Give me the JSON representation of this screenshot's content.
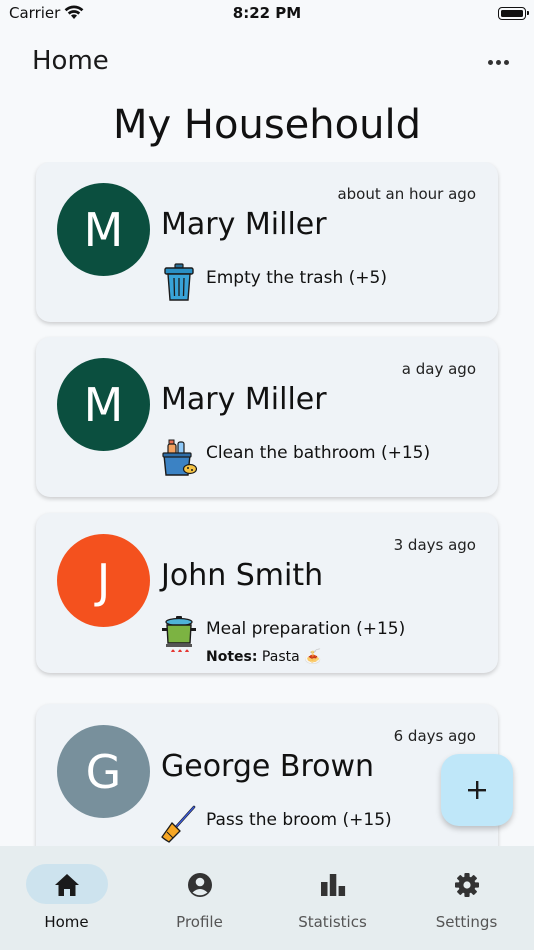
{
  "status_bar": {
    "carrier": "Carrier",
    "time": "8:22 PM",
    "wifi_icon": "wifi-icon",
    "battery_icon": "battery-full-icon"
  },
  "nav": {
    "title": "Home",
    "more_icon": "more-horizontal-icon"
  },
  "page": {
    "title": "My Househould"
  },
  "activities": [
    {
      "initial": "M",
      "avatar_color": "#0b4f3f",
      "name": "Mary Miller",
      "time": "about an hour ago",
      "task_icon": "trash-can-icon",
      "task": "Empty the trash (+5)"
    },
    {
      "initial": "M",
      "avatar_color": "#0b4f3f",
      "name": "Mary Miller",
      "time": "a day ago",
      "task_icon": "cleaning-bucket-icon",
      "task": "Clean the bathroom (+15)"
    },
    {
      "initial": "J",
      "avatar_color": "#f4511e",
      "name": "John Smith",
      "time": "3 days ago",
      "task_icon": "cooking-pot-icon",
      "task": "Meal preparation (+15)",
      "notes_label": "Notes:",
      "notes_value": "Pasta 🍝"
    },
    {
      "initial": "G",
      "avatar_color": "#78909c",
      "name": "George Brown",
      "time": "6 days ago",
      "task_icon": "broom-icon",
      "task": "Pass the broom (+15)"
    }
  ],
  "fab": {
    "icon": "plus-icon"
  },
  "tabs": [
    {
      "label": "Home",
      "icon": "home-icon",
      "active": true
    },
    {
      "label": "Profile",
      "icon": "user-circle-icon",
      "active": false
    },
    {
      "label": "Statistics",
      "icon": "bar-chart-icon",
      "active": false
    },
    {
      "label": "Settings",
      "icon": "gear-icon",
      "active": false
    }
  ]
}
